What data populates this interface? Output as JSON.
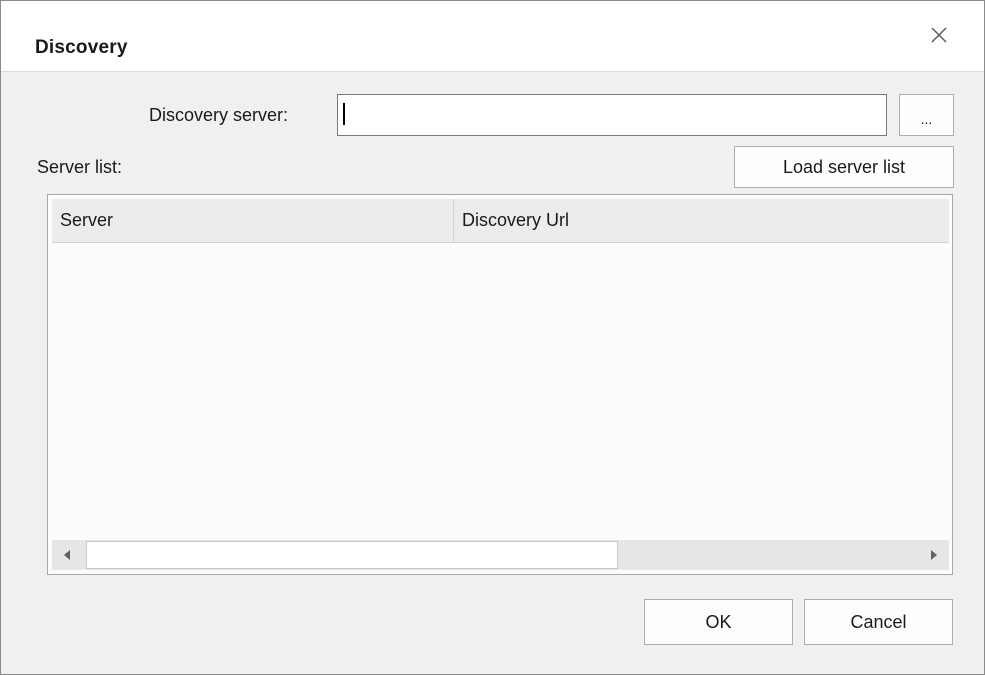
{
  "window": {
    "title": "Discovery"
  },
  "form": {
    "discovery_server_label": "Discovery server:",
    "discovery_server_value": "",
    "browse_button_label": "...",
    "server_list_label": "Server list:",
    "load_button_label": "Load server list"
  },
  "table": {
    "columns": [
      "Server",
      "Discovery Url"
    ],
    "rows": []
  },
  "footer": {
    "ok_label": "OK",
    "cancel_label": "Cancel"
  }
}
